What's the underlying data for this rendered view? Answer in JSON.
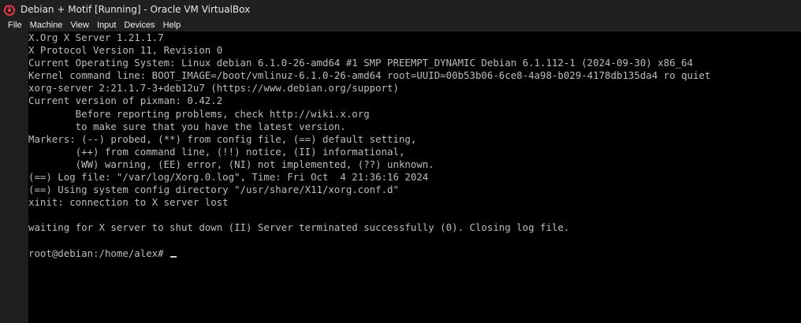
{
  "window": {
    "title": "Debian + Motif [Running] - Oracle VM VirtualBox",
    "icon": "virtualbox-icon"
  },
  "menubar": {
    "items": [
      {
        "label": "File"
      },
      {
        "label": "Machine"
      },
      {
        "label": "View"
      },
      {
        "label": "Input"
      },
      {
        "label": "Devices"
      },
      {
        "label": "Help"
      }
    ]
  },
  "console": {
    "lines": [
      "X.Org X Server 1.21.1.7",
      "X Protocol Version 11, Revision 0",
      "Current Operating System: Linux debian 6.1.0-26-amd64 #1 SMP PREEMPT_DYNAMIC Debian 6.1.112-1 (2024-09-30) x86_64",
      "Kernel command line: BOOT_IMAGE=/boot/vmlinuz-6.1.0-26-amd64 root=UUID=00b53b06-6ce8-4a98-b029-4178db135da4 ro quiet",
      "xorg-server 2:21.1.7-3+deb12u7 (https://www.debian.org/support)",
      "Current version of pixman: 0.42.2",
      "        Before reporting problems, check http://wiki.x.org",
      "        to make sure that you have the latest version.",
      "Markers: (--) probed, (**) from config file, (==) default setting,",
      "        (++) from command line, (!!) notice, (II) informational,",
      "        (WW) warning, (EE) error, (NI) not implemented, (??) unknown.",
      "(==) Log file: \"/var/log/Xorg.0.log\", Time: Fri Oct  4 21:36:16 2024",
      "(==) Using system config directory \"/usr/share/X11/xorg.conf.d\"",
      "xinit: connection to X server lost",
      "",
      "waiting for X server to shut down (II) Server terminated successfully (0). Closing log file.",
      ""
    ],
    "prompt": "root@debian:/home/alex# "
  },
  "colors": {
    "titlebar_bg": "#202020",
    "console_bg": "#000000",
    "console_text": "#bdbdbd",
    "icon_accent": "#e8354a"
  }
}
